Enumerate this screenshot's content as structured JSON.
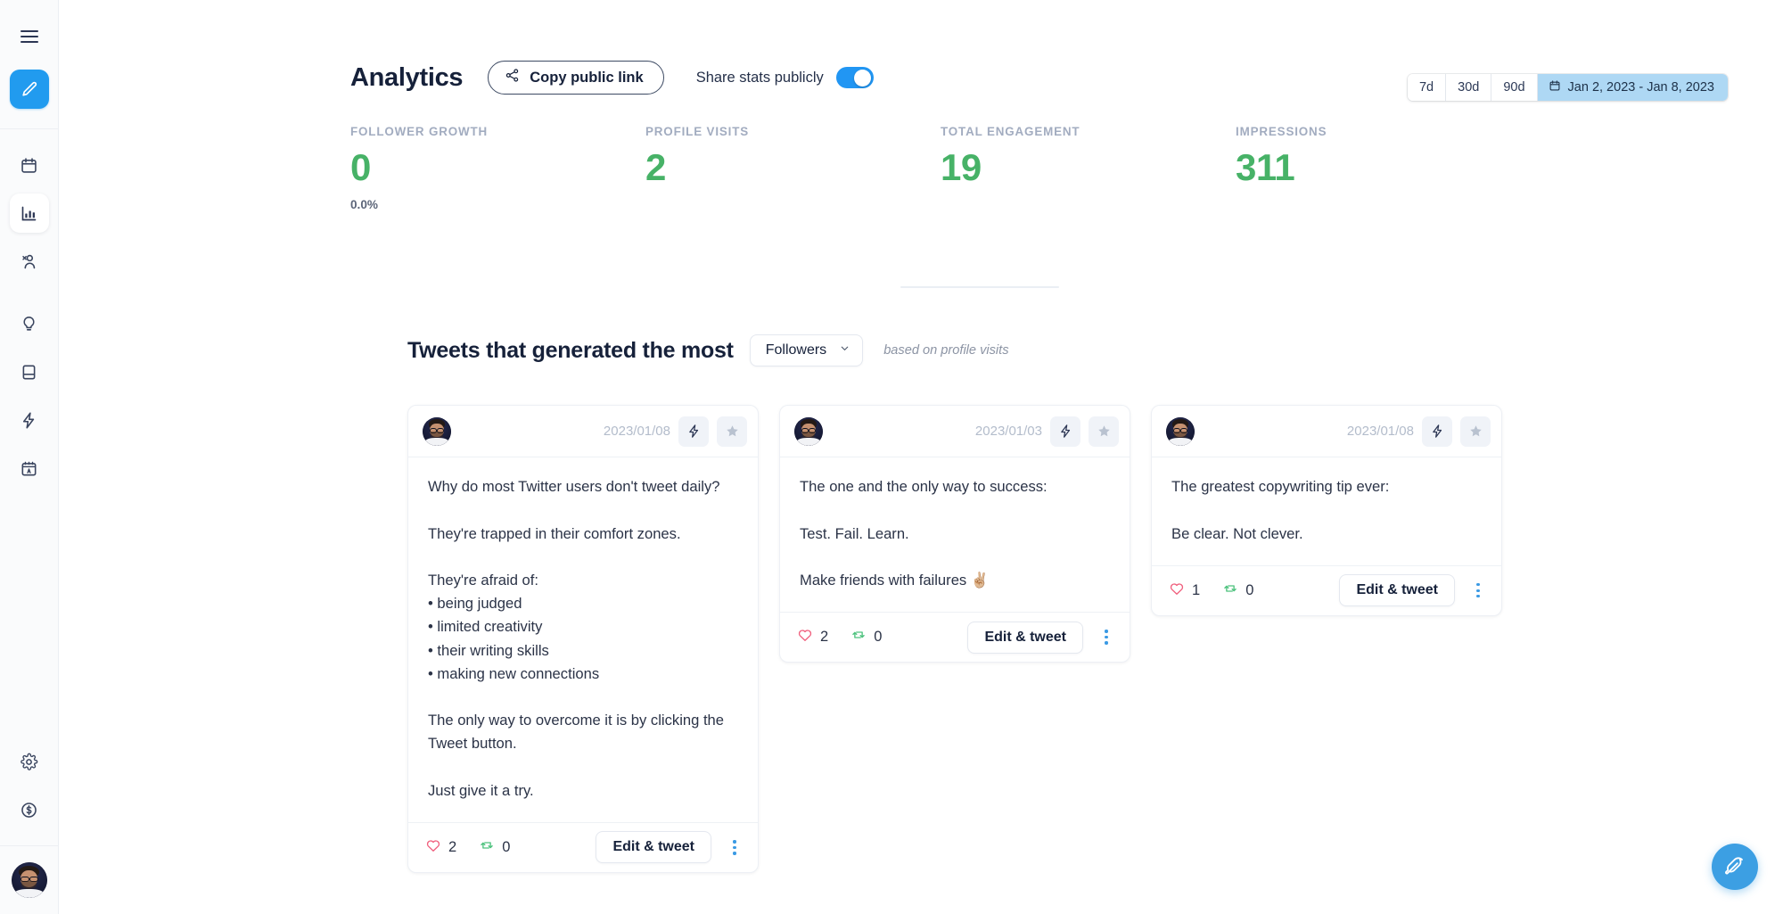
{
  "sidebar": {
    "menu_icon": "hamburger-menu-icon",
    "compose_icon": "pencil-compose-icon",
    "items": [
      {
        "icon": "calendar-icon",
        "name": "sidebar-item-calendar",
        "active": false
      },
      {
        "icon": "bar-chart-icon",
        "name": "sidebar-item-analytics",
        "active": true
      },
      {
        "icon": "users-icon",
        "name": "sidebar-item-audience",
        "active": false
      },
      {
        "icon": "lightbulb-icon",
        "name": "sidebar-item-ideas",
        "active": false
      },
      {
        "icon": "book-icon",
        "name": "sidebar-item-library",
        "active": false
      },
      {
        "icon": "bolt-icon",
        "name": "sidebar-item-automation",
        "active": false
      },
      {
        "icon": "calendar-letter-icon",
        "name": "sidebar-item-templates",
        "active": false
      }
    ],
    "bottom_items": [
      {
        "icon": "gear-icon",
        "name": "sidebar-item-settings"
      },
      {
        "icon": "dollar-circle-icon",
        "name": "sidebar-item-billing"
      }
    ],
    "avatar": "user-avatar"
  },
  "header": {
    "title": "Analytics",
    "copy_link_label": "Copy public link",
    "copy_link_icon": "share-icon",
    "share_stats_label": "Share stats publicly",
    "share_stats_on": true
  },
  "range": {
    "buttons": [
      "7d",
      "30d",
      "90d"
    ],
    "calendar_icon": "calendar-icon",
    "selected_range": "Jan 2, 2023 - Jan 8, 2023"
  },
  "stats": [
    {
      "label": "FOLLOWER GROWTH",
      "value": "0",
      "sub": "0.0%"
    },
    {
      "label": "PROFILE VISITS",
      "value": "2",
      "sub": ""
    },
    {
      "label": "TOTAL ENGAGEMENT",
      "value": "19",
      "sub": ""
    },
    {
      "label": "IMPRESSIONS",
      "value": "311",
      "sub": ""
    }
  ],
  "section": {
    "title": "Tweets that generated the most",
    "select_value": "Followers",
    "select_icon": "chevron-down-icon",
    "note": "based on profile visits"
  },
  "cards": [
    {
      "date": "2023/01/08",
      "bolt_icon": "bolt-icon",
      "star_icon": "star-icon",
      "text": "Why do most Twitter users don't tweet daily?\n\nThey're trapped in their comfort zones.\n\nThey're afraid of:\n• being judged\n• limited creativity\n• their writing skills\n• making new connections\n\nThe only way to overcome it is by clicking the Tweet button.\n\nJust give it a try.",
      "likes": "2",
      "retweets": "0",
      "edit_label": "Edit & tweet",
      "like_icon": "heart-icon",
      "retweet_icon": "retweet-icon",
      "menu_icon": "kebab-menu-icon"
    },
    {
      "date": "2023/01/03",
      "bolt_icon": "bolt-icon",
      "star_icon": "star-icon",
      "text": "The one and the only way to success:\n\nTest. Fail. Learn.\n\nMake friends with failures ✌🏼",
      "likes": "2",
      "retweets": "0",
      "edit_label": "Edit & tweet",
      "like_icon": "heart-icon",
      "retweet_icon": "retweet-icon",
      "menu_icon": "kebab-menu-icon"
    },
    {
      "date": "2023/01/08",
      "bolt_icon": "bolt-icon",
      "star_icon": "star-icon",
      "text": "The greatest copywriting tip ever:\n\nBe clear. Not clever.",
      "likes": "1",
      "retweets": "0",
      "edit_label": "Edit & tweet",
      "like_icon": "heart-icon",
      "retweet_icon": "retweet-icon",
      "menu_icon": "kebab-menu-icon"
    }
  ],
  "fab": {
    "icon": "feather-compose-icon"
  },
  "colors": {
    "accent_blue": "#219bef",
    "stat_green": "#47b267",
    "range_highlight": "#aed8f4",
    "heart_red": "#f0607e",
    "retweet_green": "#4dc27d",
    "text_dark": "#16213a",
    "label_gray": "#a2acc0"
  }
}
